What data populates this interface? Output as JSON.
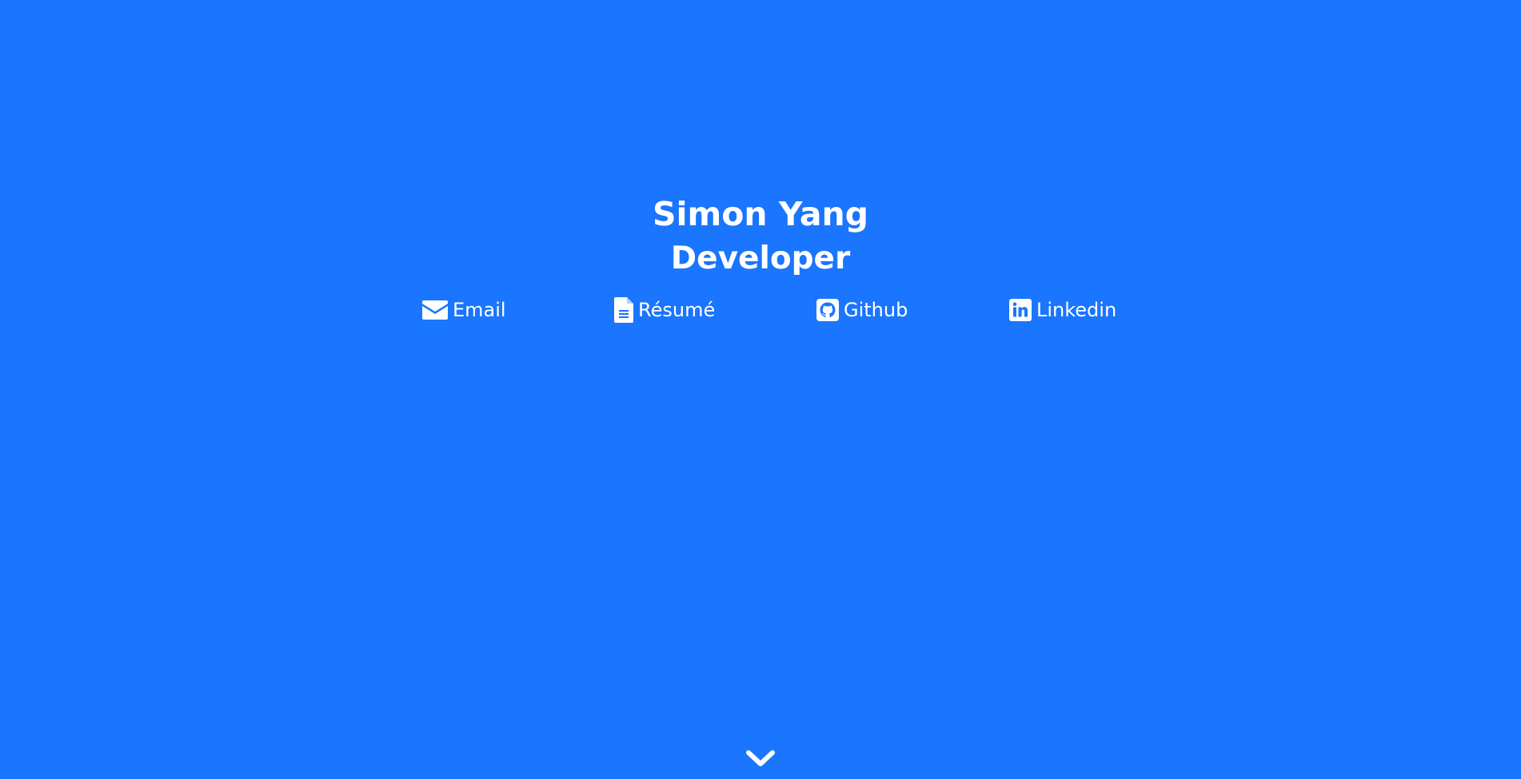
{
  "hero": {
    "name": "Simon Yang",
    "role": "Developer"
  },
  "links": [
    {
      "label": "Email",
      "icon": "envelope-icon"
    },
    {
      "label": "Résumé",
      "icon": "document-icon"
    },
    {
      "label": "Github",
      "icon": "github-icon"
    },
    {
      "label": "Linkedin",
      "icon": "linkedin-icon"
    }
  ],
  "scroll": {
    "icon": "chevron-down-icon"
  },
  "colors": {
    "background": "#1a75ff",
    "foreground": "#ffffff"
  }
}
